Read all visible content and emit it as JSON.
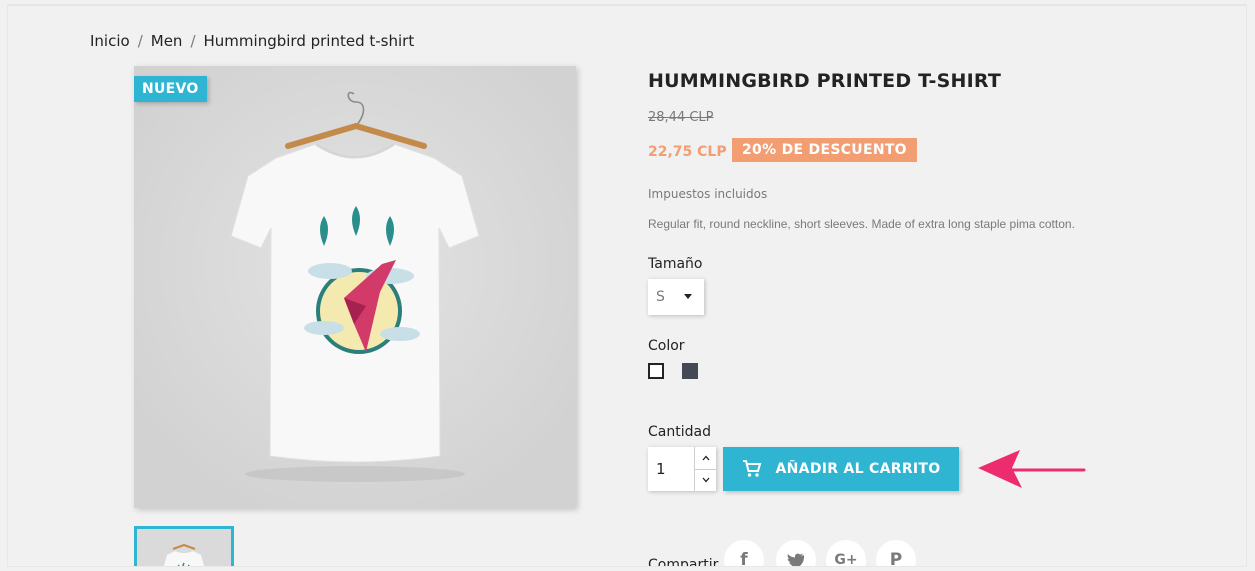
{
  "breadcrumb": {
    "items": [
      "Inicio",
      "Men",
      "Hummingbird printed t-shirt"
    ],
    "separator": "/"
  },
  "product": {
    "badge": "NUEVO",
    "title": "HUMMINGBIRD PRINTED T-SHIRT",
    "old_price": "28,44 CLP",
    "price": "22,75 CLP",
    "discount": "20% DE DESCUENTO",
    "taxes": "Impuestos incluidos",
    "description": "Regular fit, round neckline, short sleeves. Made of extra long staple pima cotton."
  },
  "size": {
    "label": "Tamaño",
    "selected": "S"
  },
  "color": {
    "label": "Color",
    "swatches": [
      "#ffffff",
      "#434a54"
    ]
  },
  "quantity": {
    "label": "Cantidad",
    "value": "1"
  },
  "cart": {
    "button_label": "AÑADIR AL CARRITO",
    "icon": "cart-icon"
  },
  "share": {
    "label": "Compartir",
    "networks": [
      "facebook",
      "twitter",
      "google-plus",
      "pinterest"
    ]
  },
  "colors": {
    "accent": "#2fb5d2",
    "discount": "#f39d72",
    "annotation": "#ec2c6f"
  }
}
